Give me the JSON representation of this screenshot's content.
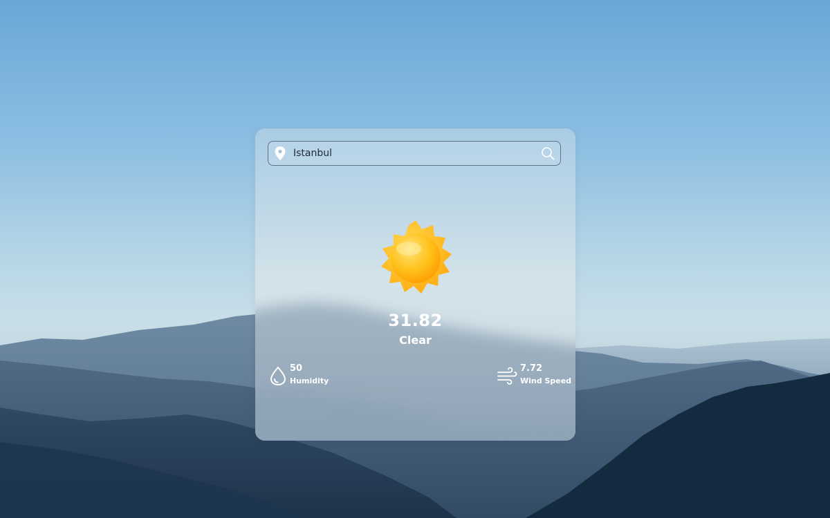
{
  "search": {
    "value": "Istanbul",
    "placeholder": ""
  },
  "weather": {
    "icon": "sun-icon",
    "temperature": "31.82",
    "description": "Clear"
  },
  "humidity": {
    "value": "50",
    "label": "Humidity",
    "icon": "water-drop-icon"
  },
  "wind": {
    "value": "7.72",
    "label": "Wind Speed",
    "icon": "wind-icon"
  },
  "colors": {
    "sky_top": "#6aa6d6",
    "mountain_dark": "#1e3550",
    "text": "#ffffff",
    "sun": "#ffb300"
  }
}
